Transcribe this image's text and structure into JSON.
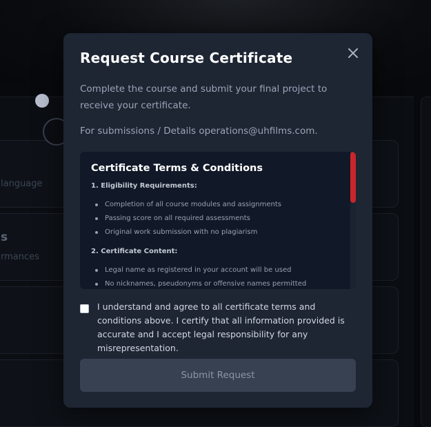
{
  "background": {
    "card_1_text": "language",
    "card_2_heading": "s",
    "card_2_text": "rmances"
  },
  "modal": {
    "title": "Request Course Certificate",
    "close_icon": "close-icon",
    "intro": "Complete the course and submit your final project to receive your certificate.",
    "contact": "For submissions / Details operations@uhfilms.com.",
    "terms": {
      "title": "Certificate Terms & Conditions",
      "sections": [
        {
          "heading": "1. Eligibility Requirements:",
          "items": [
            "Completion of all course modules and assignments",
            "Passing score on all required assessments",
            "Original work submission with no plagiarism"
          ]
        },
        {
          "heading": "2. Certificate Content:",
          "items": [
            "Legal name as registered in your account will be used",
            "No nicknames, pseudonyms or offensive names permitted"
          ]
        }
      ]
    },
    "agreement_checked": false,
    "agreement_text": "I understand and agree to all certificate terms and conditions above. I certify that all information provided is accurate and I accept legal responsibility for any misrepresentation.",
    "submit_label": "Submit Request"
  },
  "colors": {
    "modal_bg": "#1e2533",
    "terms_bg": "#111827",
    "scroll_thumb": "#c8262c",
    "button_disabled": "#374151"
  }
}
